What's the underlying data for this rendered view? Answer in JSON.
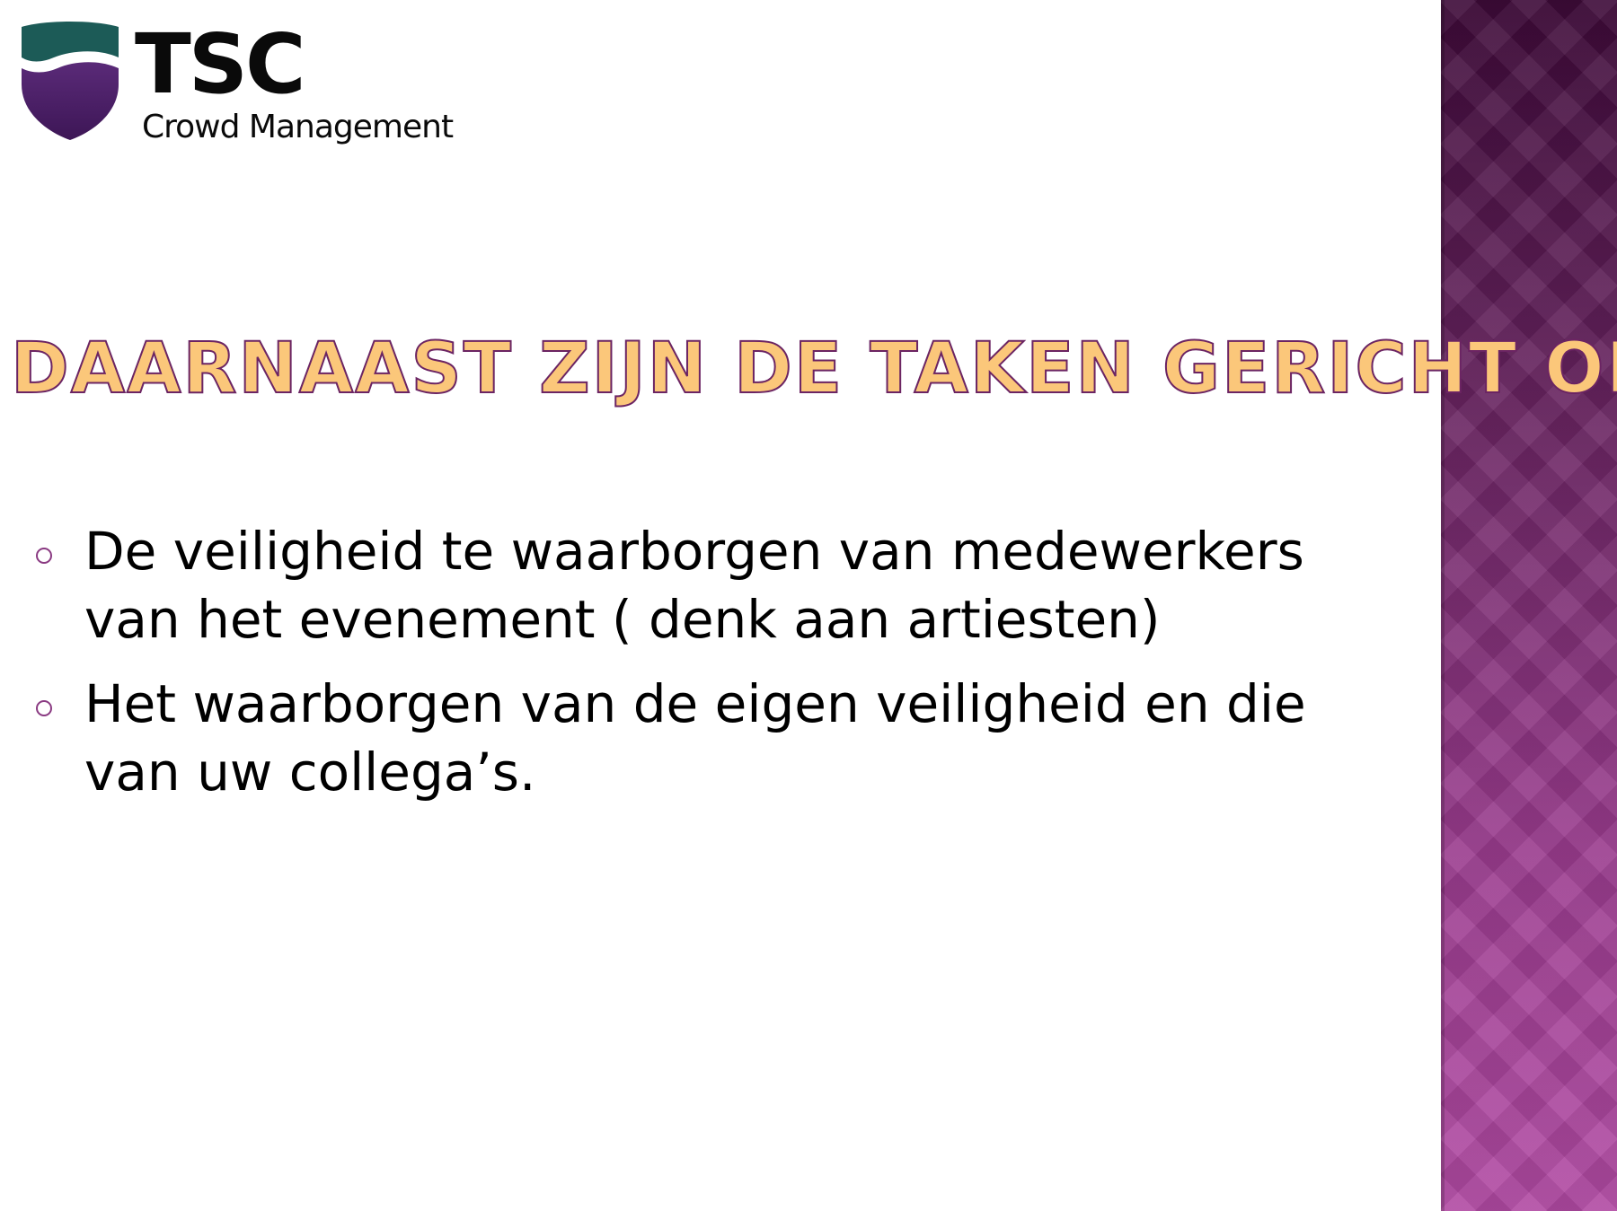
{
  "logo": {
    "name": "TSC",
    "subtitle": "Crowd Management",
    "colors": {
      "shield_top": "#1c5b57",
      "shield_bottom": "#4a2063"
    }
  },
  "slide": {
    "title": "Daarnaast zijn de taken gericht op:",
    "title_fill_color": "#fbc77a",
    "title_outline_color": "#6b2463",
    "accent_color": "#7a2f72"
  },
  "bullets": [
    {
      "text": "De veiligheid te waarborgen van medewerkers van het evenement ( denk aan artiesten)",
      "marker": "hollow-circle"
    },
    {
      "text": "Het waarborgen van de eigen veiligheid en die van uw collega’s.",
      "marker": "hollow-circle"
    }
  ]
}
